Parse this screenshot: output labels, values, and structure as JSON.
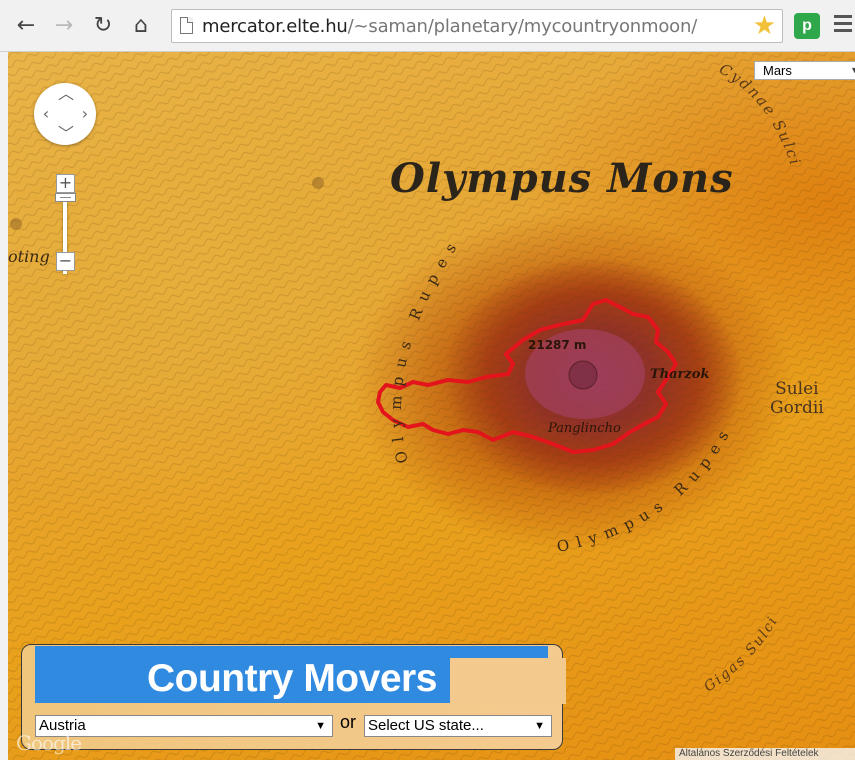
{
  "browser": {
    "url_host": "mercator.elte.hu",
    "url_path": "/~saman/planetary/mycountryonmoon/"
  },
  "map": {
    "body_select": {
      "selected": "Mars"
    },
    "labels": {
      "title": "Olympus Mons",
      "sulei_gordii_line1": "Sulei",
      "sulei_gordii_line2": "Gordii",
      "elevation": "21287 m",
      "tharzok": "Tharzok",
      "panglincho": "Panglincho",
      "oting": "oting",
      "olympus_rupes_left": "Olympus Rupes",
      "olympus_rupes_right": "Olympus Rupes",
      "cydnae_sulci": "Cydnae Sulci",
      "gigas_sulci": "Gigas Sulci"
    },
    "zoom": {
      "in_label": "+",
      "out_label": "−"
    },
    "attribution": {
      "logo": "Google",
      "terms": "Általános Szerződési Feltételek"
    }
  },
  "panel": {
    "title": "Country Movers",
    "country_select": {
      "selected": "Austria"
    },
    "or_label": "or",
    "state_select": {
      "placeholder": "Select US state..."
    }
  },
  "colors": {
    "banner": "#2f8ae0",
    "country_outline": "#e3141b",
    "star": "#f2c13a",
    "extension": "#2ea84a"
  }
}
